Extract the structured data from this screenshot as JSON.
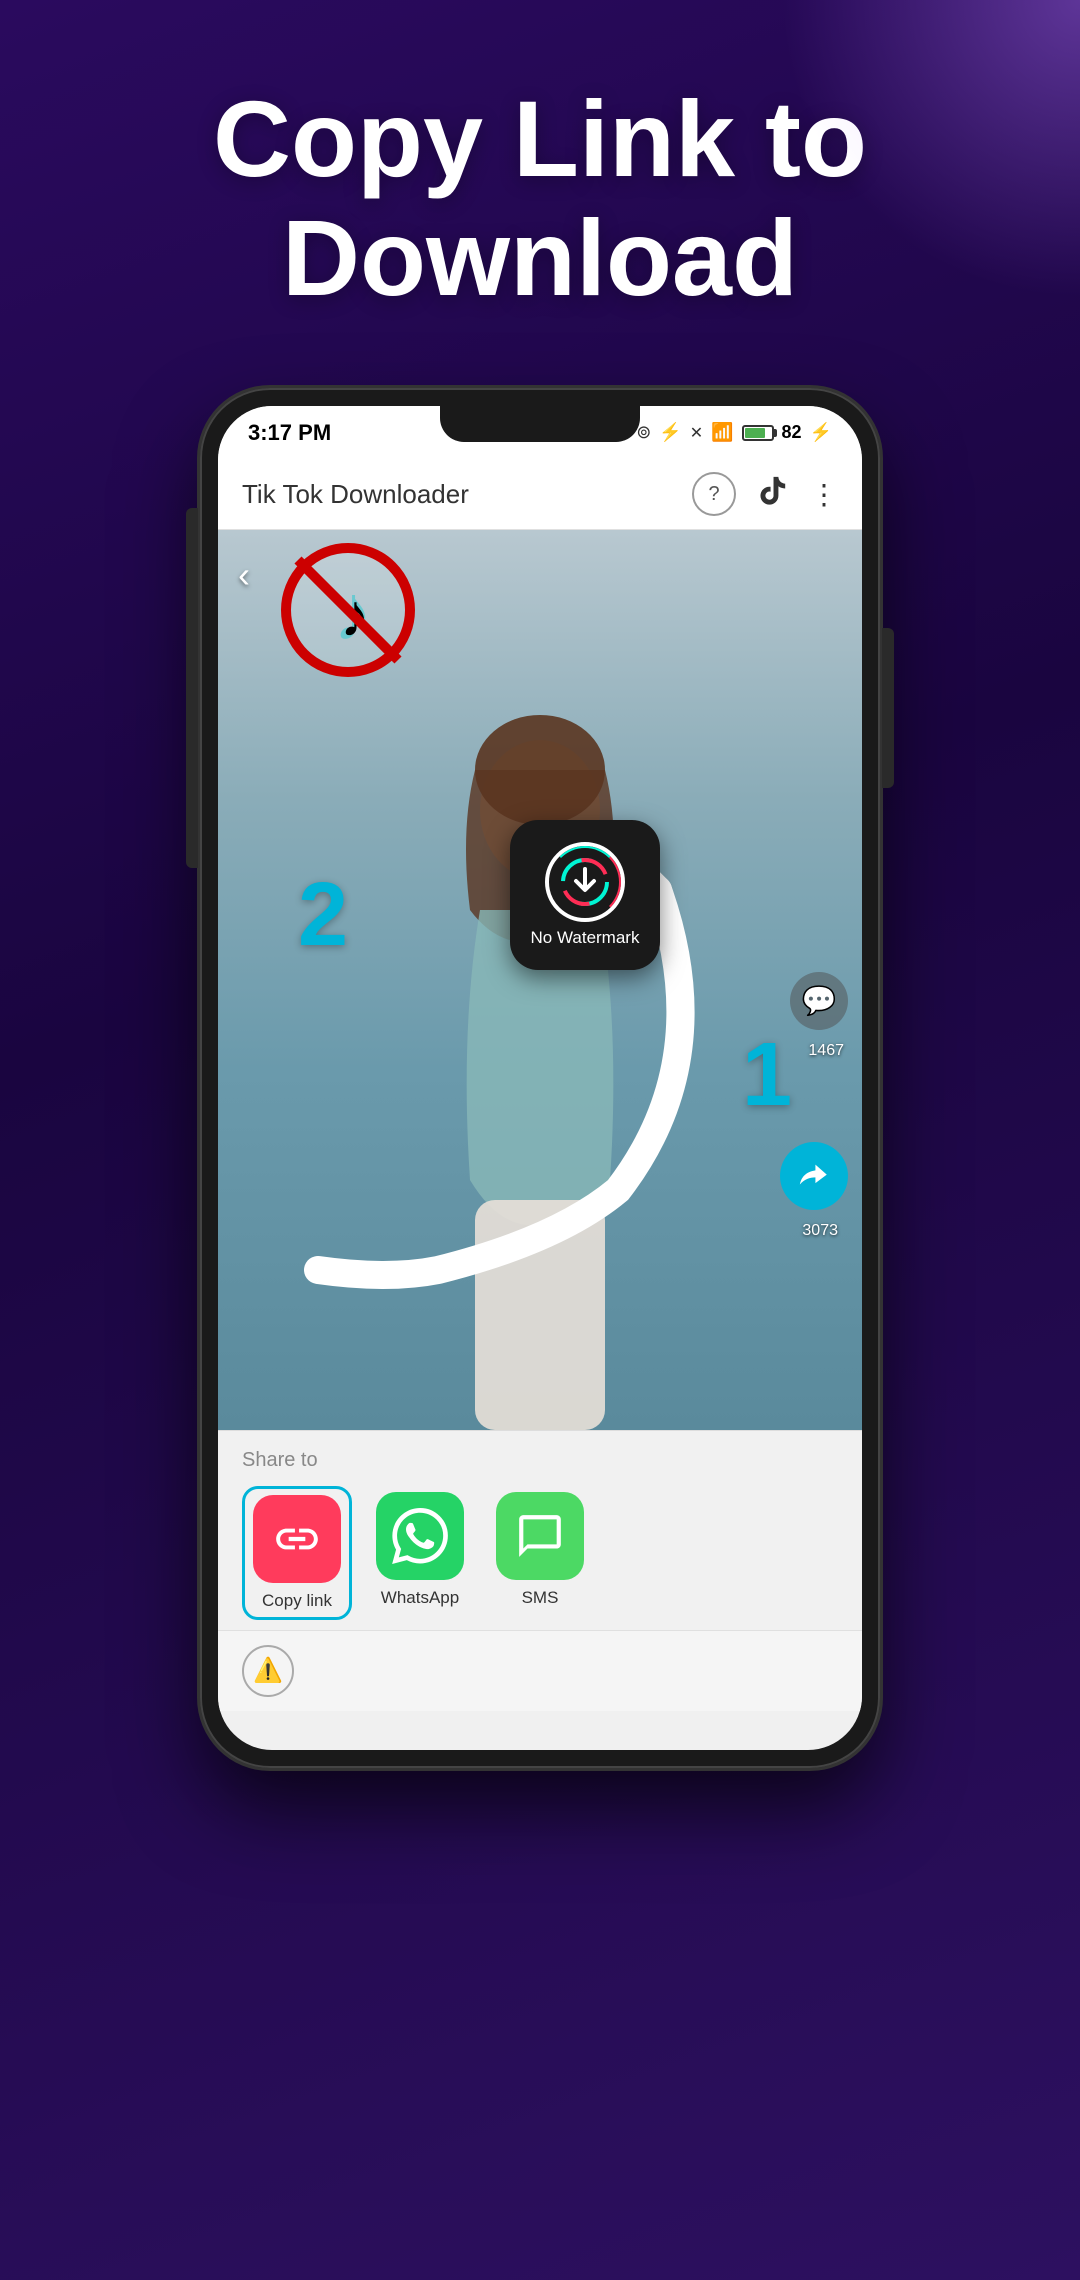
{
  "hero": {
    "title": "Copy Link to Download"
  },
  "statusBar": {
    "time": "3:17 PM",
    "battery": "82"
  },
  "appBar": {
    "title": "Tik Tok Downloader"
  },
  "noWatermarkBadge": {
    "label": "No Watermark"
  },
  "annotations": {
    "number1": "1",
    "number2": "2"
  },
  "socialCounts": {
    "comments": "1467",
    "shares": "3073"
  },
  "shareSheet": {
    "title": "Share to",
    "apps": [
      {
        "name": "Copy link",
        "icon": "🔗",
        "bg": "#ff3b5c"
      },
      {
        "name": "WhatsApp",
        "icon": "📱",
        "bg": "#25d366"
      },
      {
        "name": "SMS",
        "icon": "💬",
        "bg": "#4cd964"
      }
    ]
  }
}
